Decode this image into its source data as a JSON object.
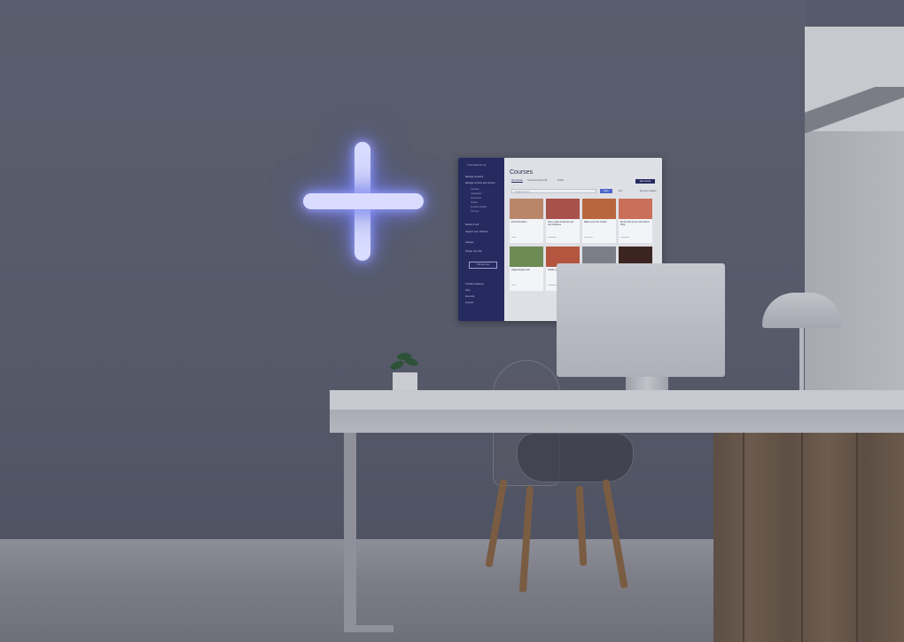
{
  "colors": {
    "wall": "#565a69",
    "neon": "#d9dcff",
    "sidebar": "#252a5f",
    "accent": "#4e66c9"
  },
  "wall_screen": {
    "brand": "THINKIFIC",
    "title": "Courses",
    "nav": [
      "Manage products",
      "Manage courses and content",
      "Courses",
      "Categories",
      "Instructors",
      "Videos",
      "Question banks",
      "Surveys",
      "Market & sell",
      "Support your students",
      "Settings",
      "Design your site"
    ],
    "outline_button": "Visit your site",
    "bottom_nav": [
      "Thinkific Academy",
      "Help",
      "Free trial",
      "Account"
    ],
    "tabs": [
      "All courses",
      "Courses being built",
      "Drafts"
    ],
    "new_button": "New course",
    "search_placeholder": "Search courses",
    "filter_label": "Filter",
    "sort_label": "Sort",
    "sortby_label": "Recently updated",
    "cards": [
      {
        "title": "Food & Nutrition",
        "meta": "Draft",
        "color": "#b9866a"
      },
      {
        "title": "How to plant & harvest your own tomatoes",
        "meta": "Published",
        "color": "#a8504a"
      },
      {
        "title": "Make a pie from scratch",
        "meta": "Published",
        "color": "#b8663e"
      },
      {
        "title": "Be the best at your own Dinner Party",
        "meta": "Published",
        "color": "#c96f5a"
      },
      {
        "title": "Vegan Recipes 101",
        "meta": "Draft",
        "color": "#6e8a55"
      },
      {
        "title": "Healthy eating",
        "meta": "Published",
        "color": "#b4553f"
      },
      {
        "title": "",
        "meta": "",
        "color": "#7c7d86"
      },
      {
        "title": "",
        "meta": "",
        "color": "#3c2520"
      }
    ]
  }
}
